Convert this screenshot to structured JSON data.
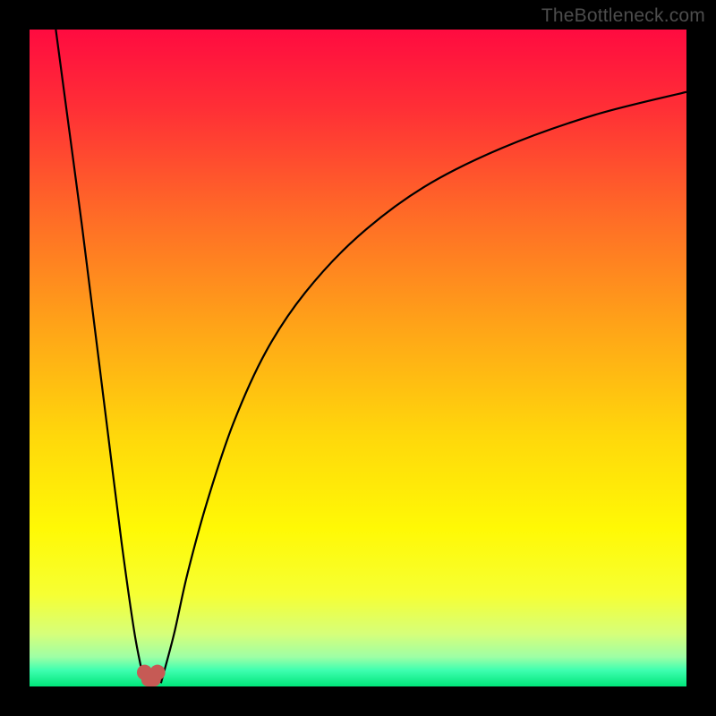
{
  "watermark": "TheBottleneck.com",
  "colors": {
    "black": "#000000",
    "curve": "#000000",
    "marker": "#c65a55",
    "gradient_stops": [
      {
        "offset": 0.0,
        "color": "#ff0b40"
      },
      {
        "offset": 0.12,
        "color": "#ff2f36"
      },
      {
        "offset": 0.28,
        "color": "#ff6a27"
      },
      {
        "offset": 0.45,
        "color": "#ffa318"
      },
      {
        "offset": 0.62,
        "color": "#ffd80b"
      },
      {
        "offset": 0.76,
        "color": "#fff905"
      },
      {
        "offset": 0.86,
        "color": "#f6ff33"
      },
      {
        "offset": 0.92,
        "color": "#d6ff7a"
      },
      {
        "offset": 0.955,
        "color": "#9effa5"
      },
      {
        "offset": 0.975,
        "color": "#3fffb0"
      },
      {
        "offset": 1.0,
        "color": "#00e57a"
      }
    ]
  },
  "chart_data": {
    "type": "line",
    "title": "",
    "xlabel": "",
    "ylabel": "",
    "xlim": [
      0,
      100
    ],
    "ylim": [
      0,
      100
    ],
    "series": [
      {
        "name": "bottleneck-curve-left",
        "x": [
          4,
          6,
          8,
          10,
          12,
          14,
          16,
          17.5
        ],
        "y": [
          100,
          85,
          70,
          54,
          38,
          22,
          8,
          0.5
        ]
      },
      {
        "name": "bottleneck-curve-right",
        "x": [
          20,
          22,
          24,
          27,
          31,
          36,
          42,
          50,
          60,
          72,
          86,
          100
        ],
        "y": [
          0.5,
          8,
          17,
          28,
          40,
          51,
          60,
          68.5,
          76,
          82,
          87,
          90.5
        ]
      }
    ],
    "marker": {
      "x": 18.5,
      "width": 3.0,
      "height": 3.0
    },
    "optimum_band_y": [
      0,
      3
    ]
  }
}
